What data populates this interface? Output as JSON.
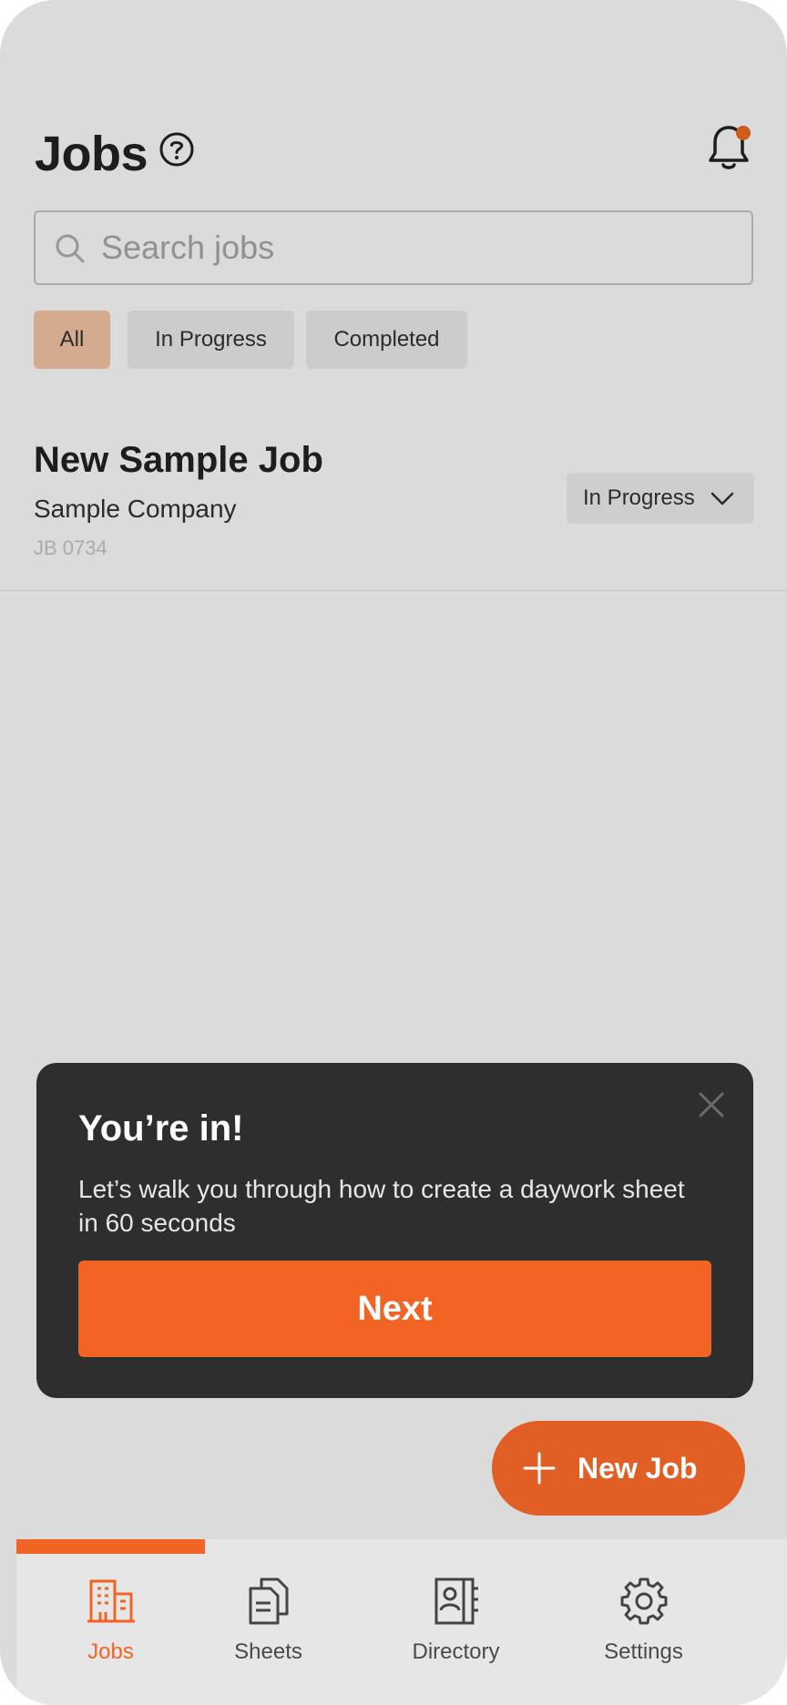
{
  "header": {
    "title": "Jobs",
    "help_icon": "question-circle-icon",
    "notification_icon": "bell-icon"
  },
  "search": {
    "placeholder": "Search jobs",
    "value": ""
  },
  "filters": [
    {
      "label": "All",
      "active": true
    },
    {
      "label": "In Progress",
      "active": false
    },
    {
      "label": "Completed",
      "active": false
    }
  ],
  "jobs": [
    {
      "title": "New Sample Job",
      "company": "Sample Company",
      "code": "JB 0734",
      "status": "In Progress"
    }
  ],
  "tooltip": {
    "title": "You’re in!",
    "body": "Let’s walk you through how to create a daywork sheet in 60 seconds",
    "button_label": "Next"
  },
  "fab": {
    "label": "New Job"
  },
  "bottom_nav": [
    {
      "label": "Jobs",
      "icon": "building-icon",
      "active": true
    },
    {
      "label": "Sheets",
      "icon": "documents-icon",
      "active": false
    },
    {
      "label": "Directory",
      "icon": "contact-book-icon",
      "active": false
    },
    {
      "label": "Settings",
      "icon": "gear-icon",
      "active": false
    }
  ],
  "colors": {
    "accent": "#f26424",
    "chip_active": "#f9c7a8",
    "tooltip_bg": "#2e2e2e"
  }
}
